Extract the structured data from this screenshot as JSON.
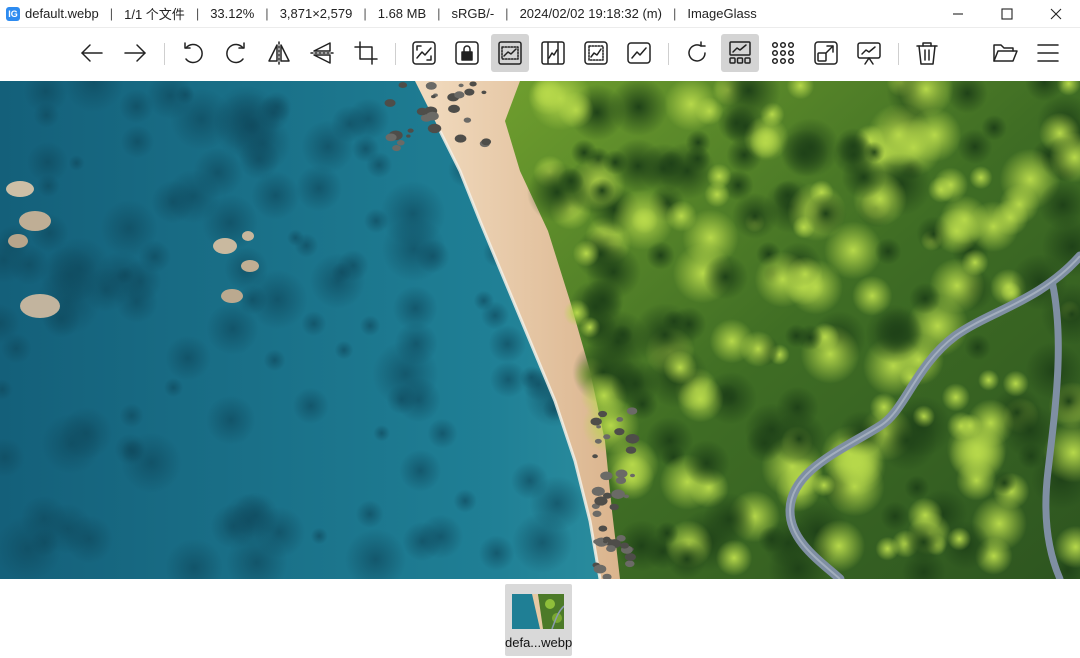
{
  "window": {
    "icon_glyph": "IG",
    "title_segments": [
      "default.webp",
      "1/1 个文件",
      "33.12%",
      "3,871×2,579",
      "1.68 MB",
      "sRGB/-",
      "2024/02/02 19:18:32 (m)",
      "ImageGlass"
    ],
    "separator": "|",
    "controls": [
      "minimize-icon",
      "maximize-icon",
      "close-icon"
    ]
  },
  "toolbar": {
    "buttons": [
      {
        "name": "previous-image",
        "icon": "arrow-left-icon"
      },
      {
        "name": "next-image",
        "icon": "arrow-right-icon"
      },
      {
        "name": "rotate-left",
        "icon": "rotate-ccw-icon"
      },
      {
        "name": "rotate-right",
        "icon": "rotate-cw-icon"
      },
      {
        "name": "flip-horizontal",
        "icon": "flip-horizontal-icon"
      },
      {
        "name": "flip-vertical",
        "icon": "flip-vertical-icon"
      },
      {
        "name": "crop",
        "icon": "crop-icon"
      },
      {
        "name": "auto-zoom",
        "icon": "auto-zoom-icon"
      },
      {
        "name": "lock-zoom",
        "icon": "lock-zoom-icon"
      },
      {
        "name": "scale-to-width",
        "icon": "scale-to-width-icon",
        "active": true
      },
      {
        "name": "scale-to-height",
        "icon": "scale-to-height-icon"
      },
      {
        "name": "scale-to-fit",
        "icon": "scale-to-fit-icon"
      },
      {
        "name": "scale-to-fill",
        "icon": "scale-to-fill-icon"
      },
      {
        "name": "refresh",
        "icon": "refresh-icon"
      },
      {
        "name": "toggle-gallery",
        "icon": "gallery-icon",
        "active": true
      },
      {
        "name": "thumbnail-grid",
        "icon": "grid-icon"
      },
      {
        "name": "fullscreen",
        "icon": "fullscreen-icon"
      },
      {
        "name": "slideshow",
        "icon": "slideshow-icon"
      },
      {
        "name": "delete",
        "icon": "trash-icon"
      },
      {
        "name": "open-file",
        "icon": "folder-open-icon"
      },
      {
        "name": "main-menu",
        "icon": "hamburger-menu-icon"
      }
    ]
  },
  "viewer": {
    "image_description_hidden": "",
    "colors": {
      "sea_deep": "#1d6f8a",
      "sea_shallow": "#43a9b4",
      "sand": "#e8c9a0",
      "forest_dark": "#2e5a1e",
      "forest_light": "#8fbf3a",
      "road": "#8a9bb0"
    }
  },
  "gallery": {
    "thumbnails": [
      {
        "label": "defa...webp",
        "selected": true
      }
    ]
  }
}
